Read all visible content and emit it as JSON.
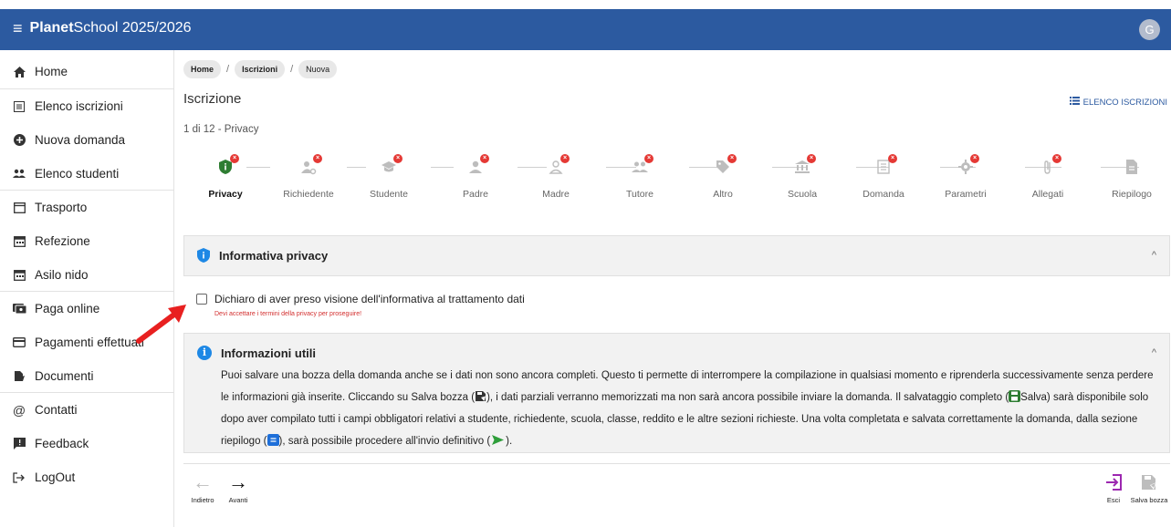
{
  "header": {
    "brand_bold": "Planet",
    "brand_rest": "School 2025/2026",
    "avatar_letter": "G"
  },
  "sidebar": {
    "items": [
      {
        "label": "Home",
        "icon": "home-icon"
      },
      {
        "label": "Elenco iscrizioni",
        "icon": "list-icon"
      },
      {
        "label": "Nuova domanda",
        "icon": "add-circle-icon"
      },
      {
        "label": "Elenco studenti",
        "icon": "people-icon"
      },
      {
        "label": "Trasporto",
        "icon": "calendar-icon"
      },
      {
        "label": "Refezione",
        "icon": "calendar-grid-icon"
      },
      {
        "label": "Asilo nido",
        "icon": "calendar-grid-icon"
      },
      {
        "label": "Paga online",
        "icon": "payment-icon"
      },
      {
        "label": "Pagamenti effettuati",
        "icon": "credit-card-icon"
      },
      {
        "label": "Documenti",
        "icon": "document-icon"
      },
      {
        "label": "Contatti",
        "icon": "at-icon"
      },
      {
        "label": "Feedback",
        "icon": "feedback-icon"
      },
      {
        "label": "LogOut",
        "icon": "logout-icon"
      }
    ]
  },
  "breadcrumb": [
    "Home",
    "Iscrizioni",
    "Nuova"
  ],
  "page": {
    "title": "Iscrizione",
    "list_link": "ELENCO ISCRIZIONI",
    "step_counter": "1 di 12 - Privacy"
  },
  "stepper": {
    "steps": [
      "Privacy",
      "Richiedente",
      "Studente",
      "Padre",
      "Madre",
      "Tutore",
      "Altro",
      "Scuola",
      "Domanda",
      "Parametri",
      "Allegati",
      "Riepilogo"
    ],
    "active_index": 0,
    "active_color": "#2e7d32",
    "error_color": "#e53935"
  },
  "privacy_panel": {
    "title": "Informativa privacy",
    "checkbox_label": "Dichiaro di aver preso visione dell'informativa al trattamento dati",
    "checked": false,
    "error": "Devi accettare i termini della privacy per proseguire!"
  },
  "info_panel": {
    "title": "Informazioni utili",
    "p1": "Puoi salvare una bozza della domanda anche se i dati non sono ancora completi. Questo ti permette di interrompere la compilazione in qualsiasi momento e riprenderla successivamente senza perdere le informazioni già inserite. Cliccando su Salva bozza (",
    "p2": "), i dati parziali verranno memorizzati ma non sarà ancora possibile inviare la domanda. Il salvataggio completo (",
    "p3": "Salva) sarà disponibile solo dopo aver compilato tutti i campi obbligatori relativi a studente, richiedente, scuola, classe, reddito e le altre sezioni richieste. Una volta completata e salvata correttamente la domanda, dalla sezione riepilogo (",
    "p4": "), sarà possibile procedere all'invio definitivo (",
    "p5": ")."
  },
  "nav": {
    "back": "Indietro",
    "forward": "Avanti",
    "exit": "Esci",
    "save_draft": "Salva bozza"
  }
}
